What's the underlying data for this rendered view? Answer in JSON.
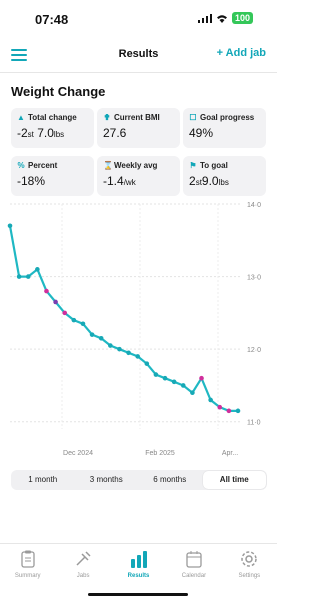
{
  "status": {
    "time": "07:48",
    "battery": "100"
  },
  "header": {
    "title": "Results",
    "add_label": "+ Add jab"
  },
  "section": {
    "title": "Weight Change"
  },
  "stats": [
    {
      "label": "Total change",
      "icon": "person-icon",
      "value": "-2",
      "unit1": "st",
      "value2": " 7.0",
      "unit2": "lbs"
    },
    {
      "label": "Current BMI",
      "icon": "figure-icon",
      "value": "27.6"
    },
    {
      "label": "Goal progress",
      "icon": "trophy-icon",
      "value": "49%"
    },
    {
      "label": "Percent",
      "icon": "percent-icon",
      "value": "-18%"
    },
    {
      "label": "Weekly avg",
      "icon": "hourglass-icon",
      "value": "-1.4",
      "unit1": "/wk"
    },
    {
      "label": "To goal",
      "icon": "flag-icon",
      "value": "2",
      "unit1": "st",
      "value2": "9.0",
      "unit2": "lbs"
    }
  ],
  "chart_data": {
    "type": "line",
    "x_tick_labels": [
      "Dec 2024",
      "Feb 2025",
      "Apr..."
    ],
    "y_tick_labels": [
      "14·0",
      "13·0",
      "12·0",
      "11·0"
    ],
    "ylim": [
      10.9,
      14.0
    ],
    "grid": true,
    "colors": {
      "line": "#1fb8c3",
      "point_teal": "#17a9b6",
      "point_magenta": "#d02f9c",
      "point_purple": "#7a3fb0"
    },
    "series": [
      {
        "values": [
          13.7,
          13.0,
          13.0,
          13.1,
          12.8,
          12.65,
          12.5,
          12.4,
          12.35,
          12.2,
          12.15,
          12.05,
          12.0,
          11.95,
          11.9,
          11.8,
          11.65,
          11.6,
          11.55,
          11.5,
          11.4,
          11.6,
          11.3,
          11.2,
          11.15,
          11.15
        ],
        "point_types": [
          "t",
          "t",
          "t",
          "t",
          "m",
          "p",
          "m",
          "t",
          "t",
          "t",
          "t",
          "t",
          "t",
          "t",
          "t",
          "t",
          "t",
          "t",
          "t",
          "t",
          "t",
          "m",
          "t",
          "m",
          "m",
          "t"
        ]
      }
    ]
  },
  "ranges": [
    "1 month",
    "3 months",
    "6 months",
    "All time"
  ],
  "tabs": [
    "Summary",
    "Jabs",
    "Results",
    "Calendar",
    "Settings"
  ]
}
